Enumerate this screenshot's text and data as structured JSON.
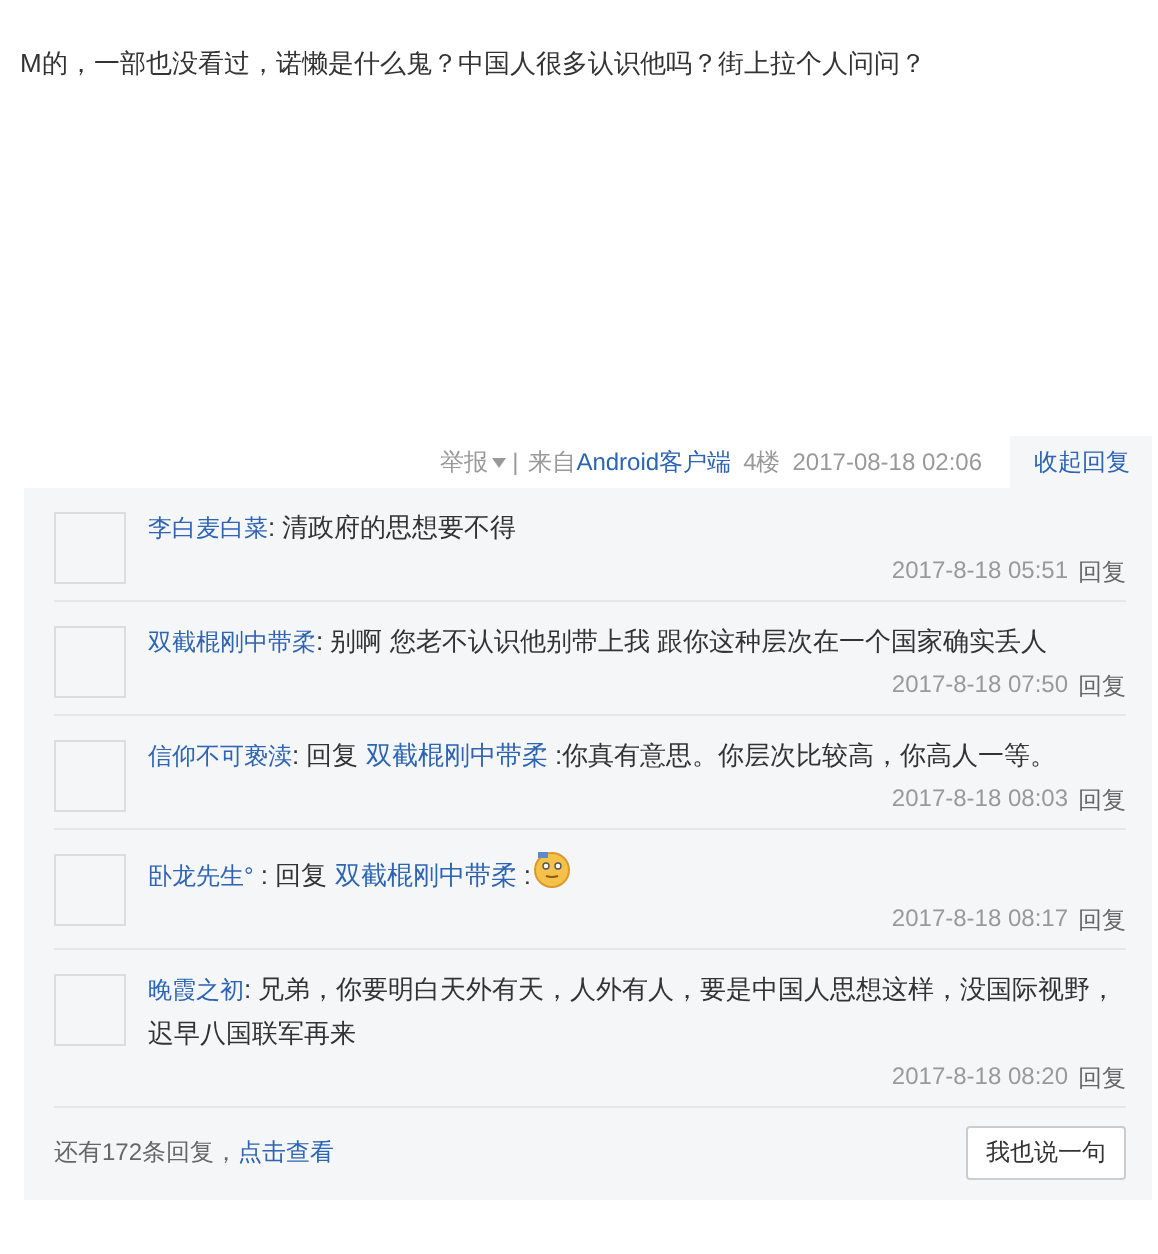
{
  "post": {
    "text": "M的，一部也没看过，诺懒是什么鬼？中国人很多认识他吗？街上拉个人问问？"
  },
  "meta": {
    "report": "举报",
    "separator": "|",
    "from": "来自",
    "client": "Android客户端",
    "floor": "4楼",
    "time": "2017-08-18 02:06",
    "collapse": "收起回复"
  },
  "replies": [
    {
      "name": "李白麦白菜",
      "segments": [
        {
          "kind": "text",
          "text": ": 清政府的思想要不得"
        }
      ],
      "time": "2017-8-18 05:51",
      "reply": "回复"
    },
    {
      "name": "双截棍刚中带柔",
      "segments": [
        {
          "kind": "text",
          "text": ": 别啊 您老不认识他别带上我 跟你这种层次在一个国家确实丢人"
        }
      ],
      "time": "2017-8-18 07:50",
      "reply": "回复"
    },
    {
      "name": "信仰不可亵渎",
      "segments": [
        {
          "kind": "text",
          "text": ": 回复 "
        },
        {
          "kind": "link",
          "text": "双截棍刚中带柔"
        },
        {
          "kind": "text",
          "text": " :你真有意思。你层次比较高，你高人一等。"
        }
      ],
      "time": "2017-8-18 08:03",
      "reply": "回复"
    },
    {
      "name": "卧龙先生°",
      "segments": [
        {
          "kind": "text",
          "text": " : 回复 "
        },
        {
          "kind": "link",
          "text": "双截棍刚中带柔"
        },
        {
          "kind": "text",
          "text": " :"
        },
        {
          "kind": "emoji"
        }
      ],
      "time": "2017-8-18 08:17",
      "reply": "回复"
    },
    {
      "name": "晚霞之初",
      "segments": [
        {
          "kind": "text",
          "text": ": 兄弟，你要明白天外有天，人外有人，要是中国人思想这样，没国际视野，迟早八国联军再来"
        }
      ],
      "time": "2017-8-18 08:20",
      "reply": "回复"
    }
  ],
  "footer": {
    "more": "还有172条回复，",
    "view": "点击查看",
    "button": "我也说一句"
  }
}
